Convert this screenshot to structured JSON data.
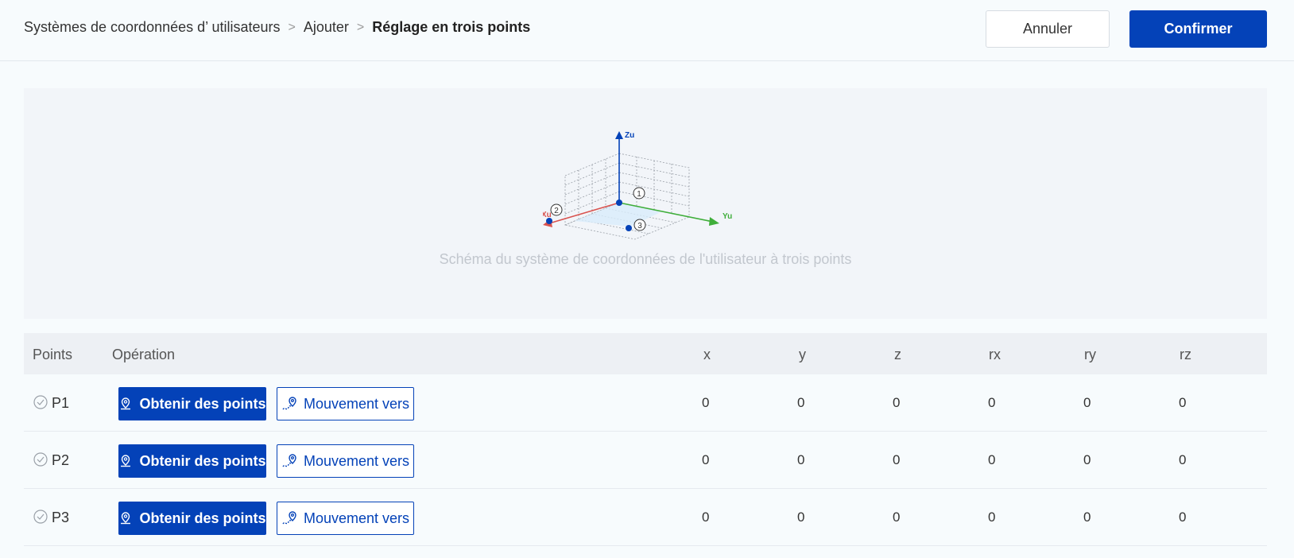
{
  "breadcrumb": {
    "item1": "Systèmes de coordonnées d’  utilisateurs",
    "sep": ">",
    "item2": "Ajouter",
    "current": "Réglage en trois points"
  },
  "actions": {
    "cancel": "Annuler",
    "confirm": "Confirmer"
  },
  "diagram": {
    "caption": "Schéma du système de coordonnées de l'utilisateur à trois points",
    "axis_z": "Zu",
    "axis_x": "Xu",
    "axis_y": "Yu",
    "marker1": "1",
    "marker2": "2",
    "marker3": "3"
  },
  "table": {
    "headers": {
      "points": "Points",
      "operation": "Opération",
      "x": "x",
      "y": "y",
      "z": "z",
      "rx": "rx",
      "ry": "ry",
      "rz": "rz"
    },
    "rows": [
      {
        "name": "P1",
        "get_label": "Obtenir des points",
        "move_label": "Mouvement vers",
        "x": "0",
        "y": "0",
        "z": "0",
        "rx": "0",
        "ry": "0",
        "rz": "0"
      },
      {
        "name": "P2",
        "get_label": "Obtenir des points",
        "move_label": "Mouvement vers",
        "x": "0",
        "y": "0",
        "z": "0",
        "rx": "0",
        "ry": "0",
        "rz": "0"
      },
      {
        "name": "P3",
        "get_label": "Obtenir des points",
        "move_label": "Mouvement vers",
        "x": "0",
        "y": "0",
        "z": "0",
        "rx": "0",
        "ry": "0",
        "rz": "0"
      }
    ]
  },
  "colors": {
    "primary": "#0442b8",
    "axis_x": "#d9534f",
    "axis_y": "#3fae3a",
    "axis_z": "#0442b8"
  }
}
